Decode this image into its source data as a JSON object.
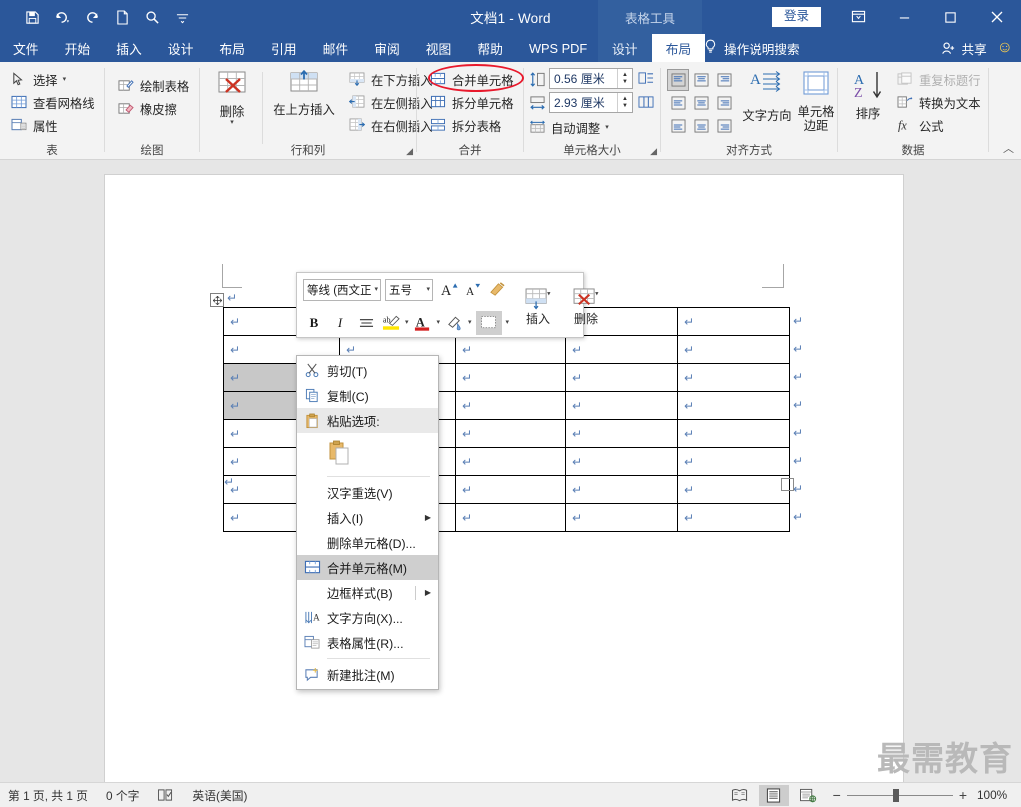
{
  "titlebar": {
    "document_title": "文档1  -  Word",
    "contextual_tool_label": "表格工具",
    "signin_label": "登录",
    "quick_access": [
      {
        "name": "save-icon",
        "label": "保存"
      },
      {
        "name": "undo-icon",
        "label": "撤消"
      },
      {
        "name": "redo-icon",
        "label": "恢复"
      },
      {
        "name": "new-doc-icon",
        "label": "新建"
      },
      {
        "name": "find-icon",
        "label": "查找"
      },
      {
        "name": "customize-qat-icon",
        "label": "自定义快速访问工具栏"
      }
    ],
    "window_buttons": [
      {
        "name": "ribbon-display-options",
        "glyph": "▣"
      },
      {
        "name": "minimize",
        "glyph": "—"
      },
      {
        "name": "maximize",
        "glyph": "□"
      },
      {
        "name": "close",
        "glyph": "✕"
      }
    ]
  },
  "tabs": {
    "main": [
      "文件",
      "开始",
      "插入",
      "设计",
      "布局",
      "引用",
      "邮件",
      "审阅",
      "视图",
      "帮助",
      "WPS PDF"
    ],
    "contextual": [
      "设计",
      "布局"
    ],
    "active_contextual": "布局",
    "tellme_placeholder": "操作说明搜索",
    "share_label": "共享"
  },
  "ribbon": {
    "groups": [
      {
        "label": "表",
        "items": [
          {
            "label": "选择",
            "icon": "cursor-select-icon",
            "dropdown": true
          },
          {
            "label": "查看网格线",
            "icon": "view-gridlines-icon",
            "dropdown": false
          },
          {
            "label": "属性",
            "icon": "table-properties-icon",
            "dropdown": false
          }
        ]
      },
      {
        "label": "绘图",
        "items": [
          {
            "label": "绘制表格",
            "icon": "draw-table-icon",
            "dropdown": false
          },
          {
            "label": "橡皮擦",
            "icon": "eraser-icon",
            "dropdown": false
          }
        ]
      },
      {
        "label": "行和列",
        "items": [
          {
            "label": "删除",
            "icon": "delete-table-icon",
            "dropdown": true
          },
          {
            "label": "在上方插入",
            "icon": "insert-above-icon",
            "dropdown": false
          },
          {
            "label": "在下方插入",
            "icon": "insert-below-icon",
            "dropdown": false
          },
          {
            "label": "在左侧插入",
            "icon": "insert-left-icon",
            "dropdown": false
          },
          {
            "label": "在右侧插入",
            "icon": "insert-right-icon",
            "dropdown": false
          }
        ]
      },
      {
        "label": "合并",
        "items": [
          {
            "label": "合并单元格",
            "icon": "merge-cells-icon",
            "highlighted": true
          },
          {
            "label": "拆分单元格",
            "icon": "split-cells-icon"
          },
          {
            "label": "拆分表格",
            "icon": "split-table-icon"
          }
        ]
      },
      {
        "label": "单元格大小",
        "items": [
          {
            "label": "自动调整",
            "icon": "autofit-icon",
            "dropdown": true
          }
        ],
        "height_value": "0.56 厘米",
        "width_value": "2.93 厘米",
        "distribute_rows_icon": "distribute-rows-icon",
        "distribute_cols_icon": "distribute-columns-icon"
      },
      {
        "label": "对齐方式",
        "items": [
          {
            "label": "文字方向",
            "icon": "text-direction-icon"
          },
          {
            "label": "单元格\n边距",
            "icon": "cell-margins-icon"
          }
        ],
        "align_buttons": [
          "align-top-left",
          "align-top-center",
          "align-top-right",
          "align-middle-left",
          "align-middle-center",
          "align-middle-right",
          "align-bottom-left",
          "align-bottom-center",
          "align-bottom-right"
        ],
        "align_selected": "align-top-left"
      },
      {
        "label": "数据",
        "items": [
          {
            "label": "排序",
            "icon": "sort-az-icon"
          },
          {
            "label": "重复标题行",
            "icon": "repeat-header-icon",
            "disabled": true
          },
          {
            "label": "转换为文本",
            "icon": "convert-to-text-icon",
            "disabled": false
          },
          {
            "label": "公式",
            "icon": "formula-icon",
            "disabled": false
          }
        ]
      }
    ]
  },
  "minitoolbar": {
    "font_name": "等线 (西文正",
    "font_size": "五号",
    "grow_font": "A",
    "shrink_font": "A",
    "format_painter_icon": "format-painter-icon",
    "bold": "B",
    "italic": "I",
    "styles_icon": "styles-icon",
    "highlight_icon": "text-highlight-icon",
    "font_color_icon": "font-color-icon",
    "shading_icon": "shading-icon",
    "borders_icon": "borders-icon",
    "insert_label": "插入",
    "delete_label": "删除"
  },
  "contextmenu": {
    "items": [
      {
        "label": "剪切(T)",
        "icon": "scissors-icon",
        "type": "item"
      },
      {
        "label": "复制(C)",
        "icon": "copy-icon",
        "type": "item"
      },
      {
        "label": "粘贴选项:",
        "icon": "paste-icon",
        "type": "header"
      },
      {
        "label": "",
        "icon": "paste-keep-source-icon",
        "type": "paste-gallery"
      },
      {
        "type": "separator"
      },
      {
        "label": "汉字重选(V)",
        "icon": "",
        "type": "item"
      },
      {
        "label": "插入(I)",
        "icon": "",
        "type": "submenu"
      },
      {
        "label": "删除单元格(D)...",
        "icon": "",
        "type": "item"
      },
      {
        "label": "合并单元格(M)",
        "icon": "merge-cells-icon",
        "type": "item",
        "highlighted": true
      },
      {
        "label": "边框样式(B)",
        "icon": "",
        "type": "submenu"
      },
      {
        "label": "文字方向(X)...",
        "icon": "text-direction-icon",
        "type": "item"
      },
      {
        "label": "表格属性(R)...",
        "icon": "table-properties-icon",
        "type": "item"
      },
      {
        "type": "separator"
      },
      {
        "label": "新建批注(M)",
        "icon": "new-comment-icon",
        "type": "item"
      }
    ]
  },
  "document": {
    "table": {
      "rows": 8,
      "cols": 5,
      "cell_marker": "↵",
      "selected_cells": [
        {
          "row": 2,
          "col": 0
        },
        {
          "row": 3,
          "col": 0
        }
      ]
    },
    "paragraph_marker": "↵"
  },
  "statusbar": {
    "page_info": "第 1 页, 共 1 页",
    "word_count": "0 个字",
    "proofing_icon": "proofing-icon",
    "language": "英语(美国)",
    "views": [
      {
        "name": "read-mode-view",
        "active": false
      },
      {
        "name": "print-layout-view",
        "active": true
      },
      {
        "name": "web-layout-view",
        "active": false
      }
    ],
    "zoom_out": "−",
    "zoom_in": "+",
    "zoom_level": "100%"
  },
  "watermark": {
    "text": "最需教育"
  },
  "colors": {
    "brand_blue": "#2b579a",
    "contextual_blue": "#33609f",
    "ribbon_bg": "#f3f3f3",
    "doc_bg": "#e6e6e6",
    "annotation_red": "#e8192c",
    "selection_gray": "#c8c8c8"
  }
}
